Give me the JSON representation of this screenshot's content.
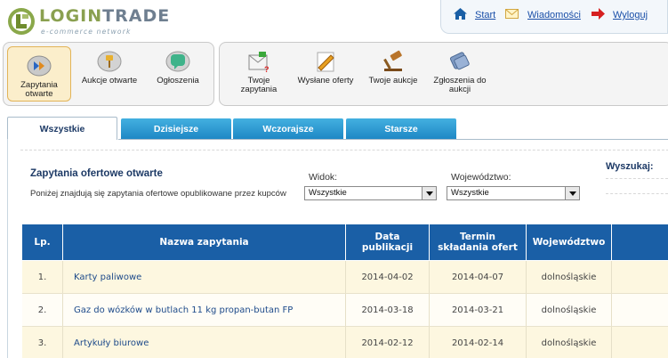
{
  "brand": {
    "name_part1": "LOGIN",
    "name_part2": "TRADE",
    "tagline": "e-commerce network"
  },
  "topnav": {
    "start": "Start",
    "messages": "Wiadomości",
    "logout": "Wyloguj"
  },
  "toolbar": {
    "group1": [
      {
        "label": "Zapytania otwarte",
        "icon": "open-requests-icon",
        "active": true
      },
      {
        "label": "Aukcje otwarte",
        "icon": "open-auctions-icon",
        "active": false
      },
      {
        "label": "Ogłoszenia",
        "icon": "announcements-icon",
        "active": false
      }
    ],
    "group2": [
      {
        "label": "Twoje zapytania",
        "icon": "my-requests-icon"
      },
      {
        "label": "Wysłane oferty",
        "icon": "sent-offers-icon"
      },
      {
        "label": "Twoje aukcje",
        "icon": "my-auctions-icon"
      },
      {
        "label": "Zgłoszenia do aukcji",
        "icon": "auction-applications-icon"
      }
    ]
  },
  "tabs": [
    {
      "label": "Wszystkie",
      "active": true
    },
    {
      "label": "Dzisiejsze",
      "active": false
    },
    {
      "label": "Wczorajsze",
      "active": false
    },
    {
      "label": "Starsze",
      "active": false
    }
  ],
  "panel": {
    "title": "Zapytania ofertowe otwarte",
    "description": "Poniżej znajdują się zapytania ofertowe opublikowane przez kupców"
  },
  "filters": {
    "view_label": "Widok:",
    "view_value": "Wszystkie",
    "region_label": "Województwo:",
    "region_value": "Wszystkie",
    "search_label": "Wyszukaj:"
  },
  "table": {
    "headers": [
      "Lp.",
      "Nazwa zapytania",
      "Data publikacji",
      "Termin składania ofert",
      "Województwo"
    ],
    "rows": [
      {
        "lp": "1.",
        "name": "Karty paliwowe",
        "published": "2014-04-02",
        "deadline": "2014-04-07",
        "region": "dolnośląskie"
      },
      {
        "lp": "2.",
        "name": "Gaz do wózków w butlach 11 kg propan-butan FP",
        "published": "2014-03-18",
        "deadline": "2014-03-21",
        "region": "dolnośląskie"
      },
      {
        "lp": "3.",
        "name": "Artykuły biurowe",
        "published": "2014-02-12",
        "deadline": "2014-02-14",
        "region": "dolnośląskie"
      }
    ]
  },
  "colors": {
    "accent_blue": "#1a5fa6",
    "tab_blue": "#2b9ad4",
    "active_tool_bg": "#fbeecb",
    "row_odd": "#fdf7e0"
  }
}
